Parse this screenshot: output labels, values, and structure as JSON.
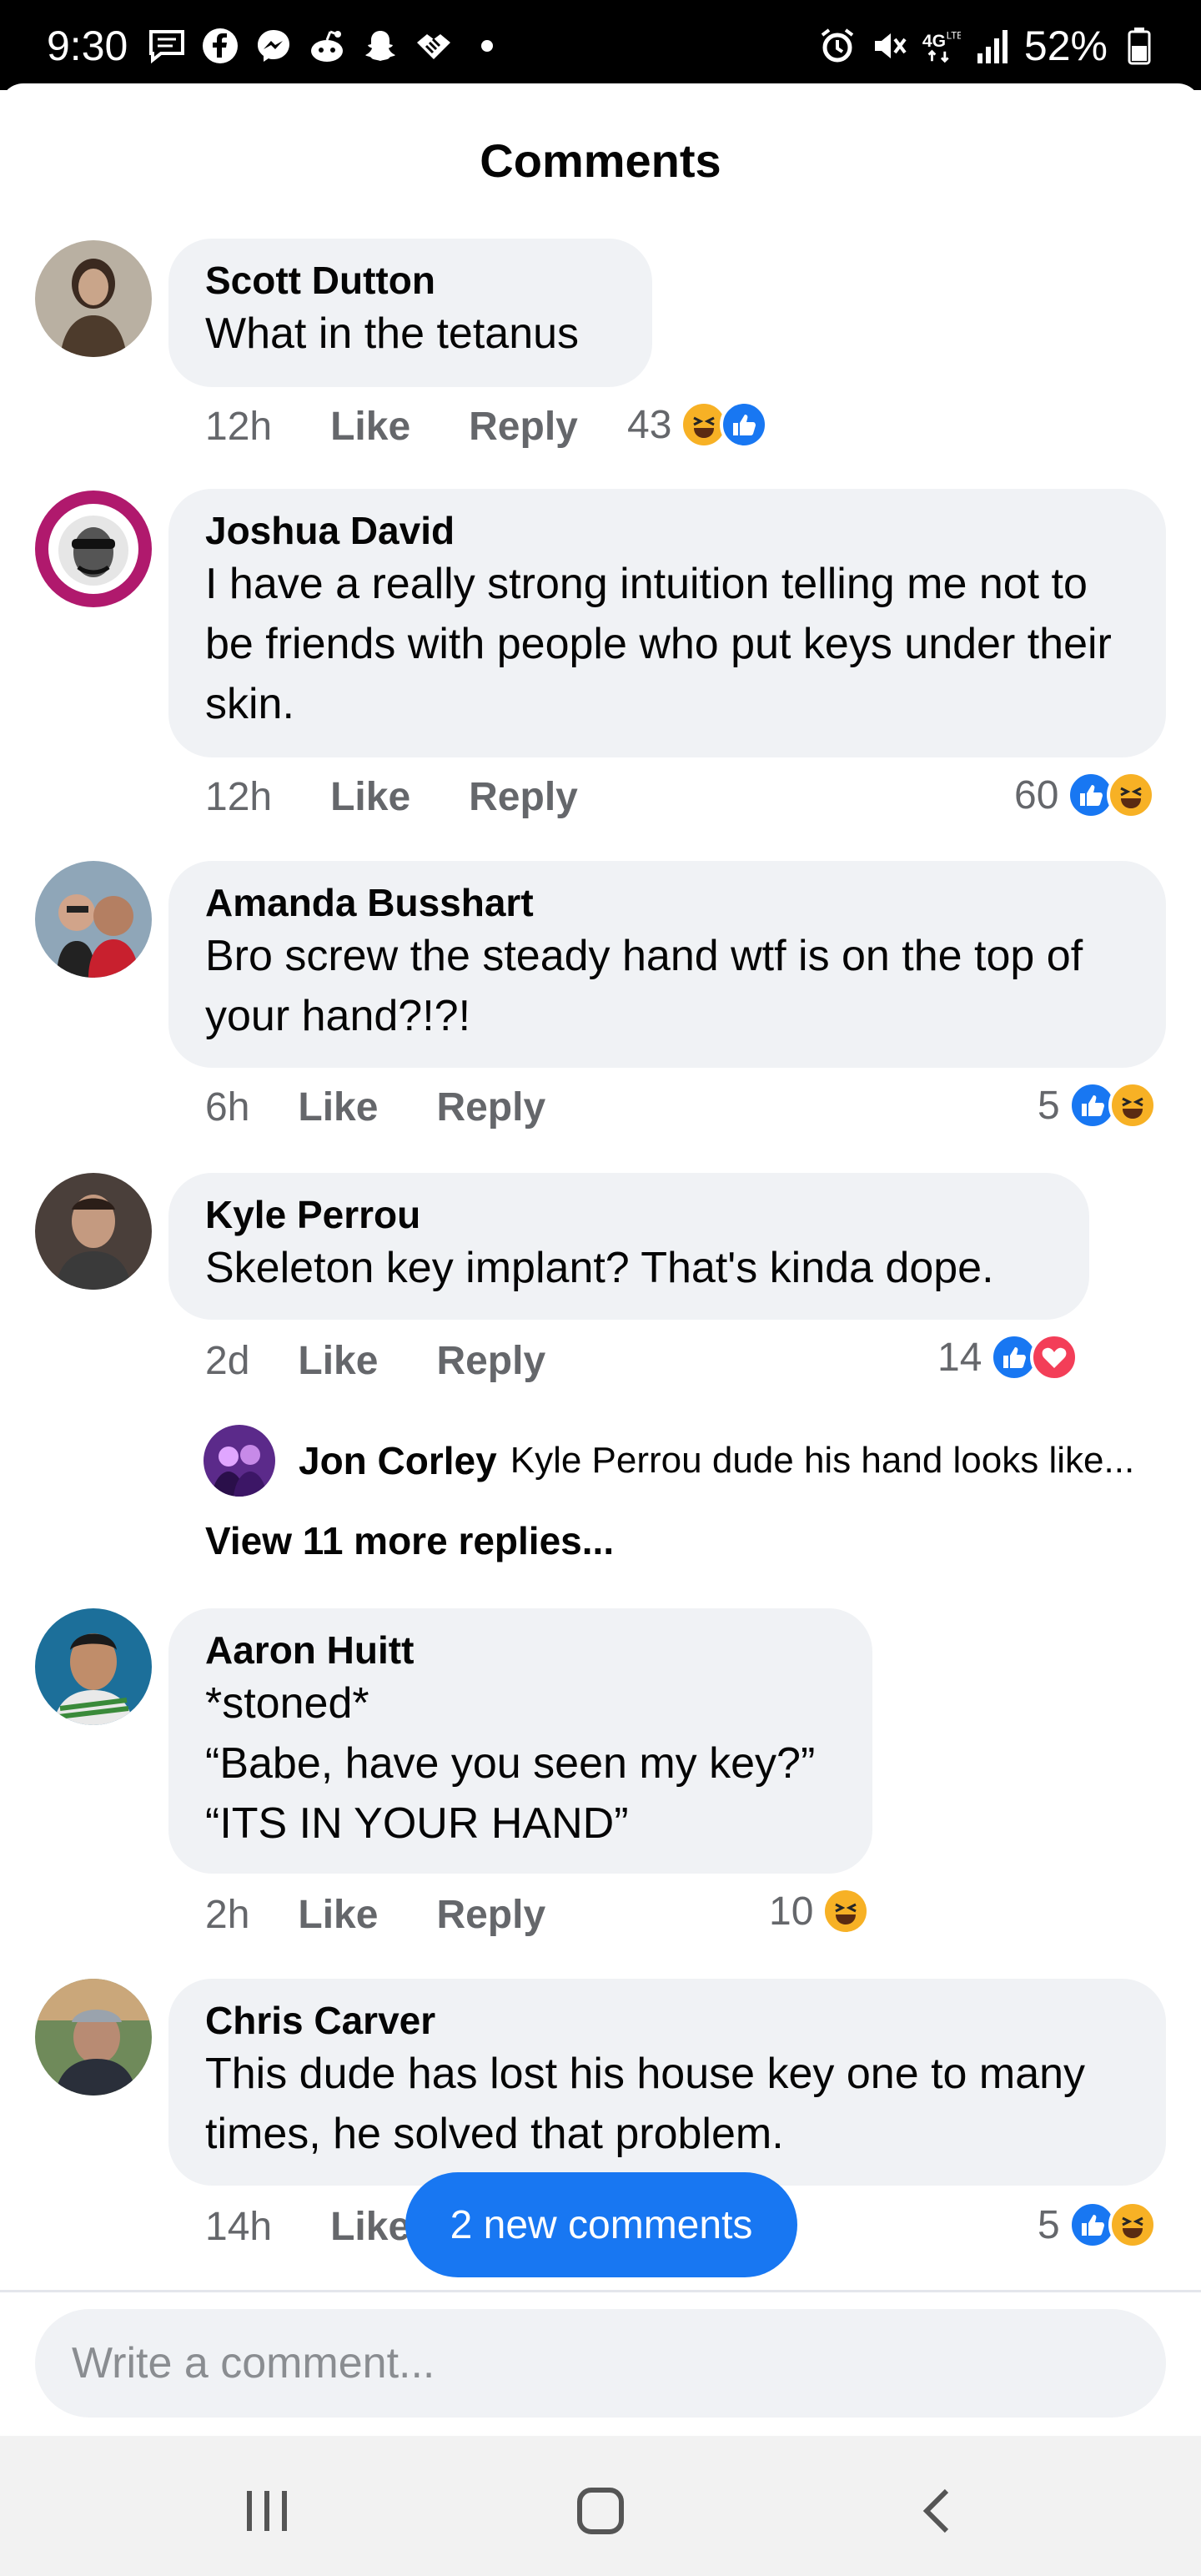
{
  "status_bar": {
    "time": "9:30",
    "battery": "52%",
    "left_icons": [
      "message-icon",
      "facebook-icon",
      "messenger-icon",
      "reddit-icon",
      "snapchat-icon",
      "handshake-icon",
      "dot-icon"
    ],
    "right_icons": [
      "alarm-icon",
      "mute-icon",
      "4g-icon",
      "signal-icon",
      "battery-icon"
    ]
  },
  "sheet": {
    "title": "Comments"
  },
  "comments": [
    {
      "author": "Scott Dutton",
      "text": "What in the tetanus",
      "time": "12h",
      "like_label": "Like",
      "reply_label": "Reply",
      "reaction_count": "43",
      "reactions": [
        "haha",
        "like"
      ]
    },
    {
      "author": "Joshua David",
      "text": "I have a really strong intuition telling me not to be friends with people who put keys under their skin.",
      "time": "12h",
      "like_label": "Like",
      "reply_label": "Reply",
      "reaction_count": "60",
      "reactions": [
        "like",
        "haha"
      ]
    },
    {
      "author": "Amanda Busshart",
      "text": "Bro screw the steady hand wtf is on the top of your hand?!?!",
      "time": "6h",
      "like_label": "Like",
      "reply_label": "Reply",
      "reaction_count": "5",
      "reactions": [
        "like",
        "haha"
      ]
    },
    {
      "author": "Kyle Perrou",
      "text": "Skeleton key implant? That's kinda dope.",
      "time": "2d",
      "like_label": "Like",
      "reply_label": "Reply",
      "reaction_count": "14",
      "reactions": [
        "like",
        "love"
      ],
      "reply_preview": {
        "author": "Jon Corley",
        "text": "Kyle Perrou dude his hand looks like..."
      },
      "more_replies": "View 11 more replies..."
    },
    {
      "author": "Aaron Huitt",
      "text_lines": [
        "*stoned*",
        "“Babe, have you seen my key?”",
        "“ITS IN YOUR HAND”"
      ],
      "time": "2h",
      "like_label": "Like",
      "reply_label": "Reply",
      "reaction_count": "10",
      "reactions": [
        "haha"
      ]
    },
    {
      "author": "Chris Carver",
      "text": "This dude has lost his house key one to many times, he solved that problem.",
      "time": "14h",
      "like_label": "Like",
      "reaction_count": "5",
      "reactions": [
        "like",
        "haha"
      ]
    }
  ],
  "new_comments_pill": "2 new comments",
  "composer": {
    "placeholder": "Write a comment..."
  },
  "nav_bar": {
    "icons": [
      "recent-apps-icon",
      "home-icon",
      "back-icon"
    ]
  },
  "colors": {
    "accent": "#1877f2",
    "bubble": "#f0f2f5",
    "meta_text": "#65676b",
    "haha": "#f7b125",
    "love": "#f33e58"
  }
}
